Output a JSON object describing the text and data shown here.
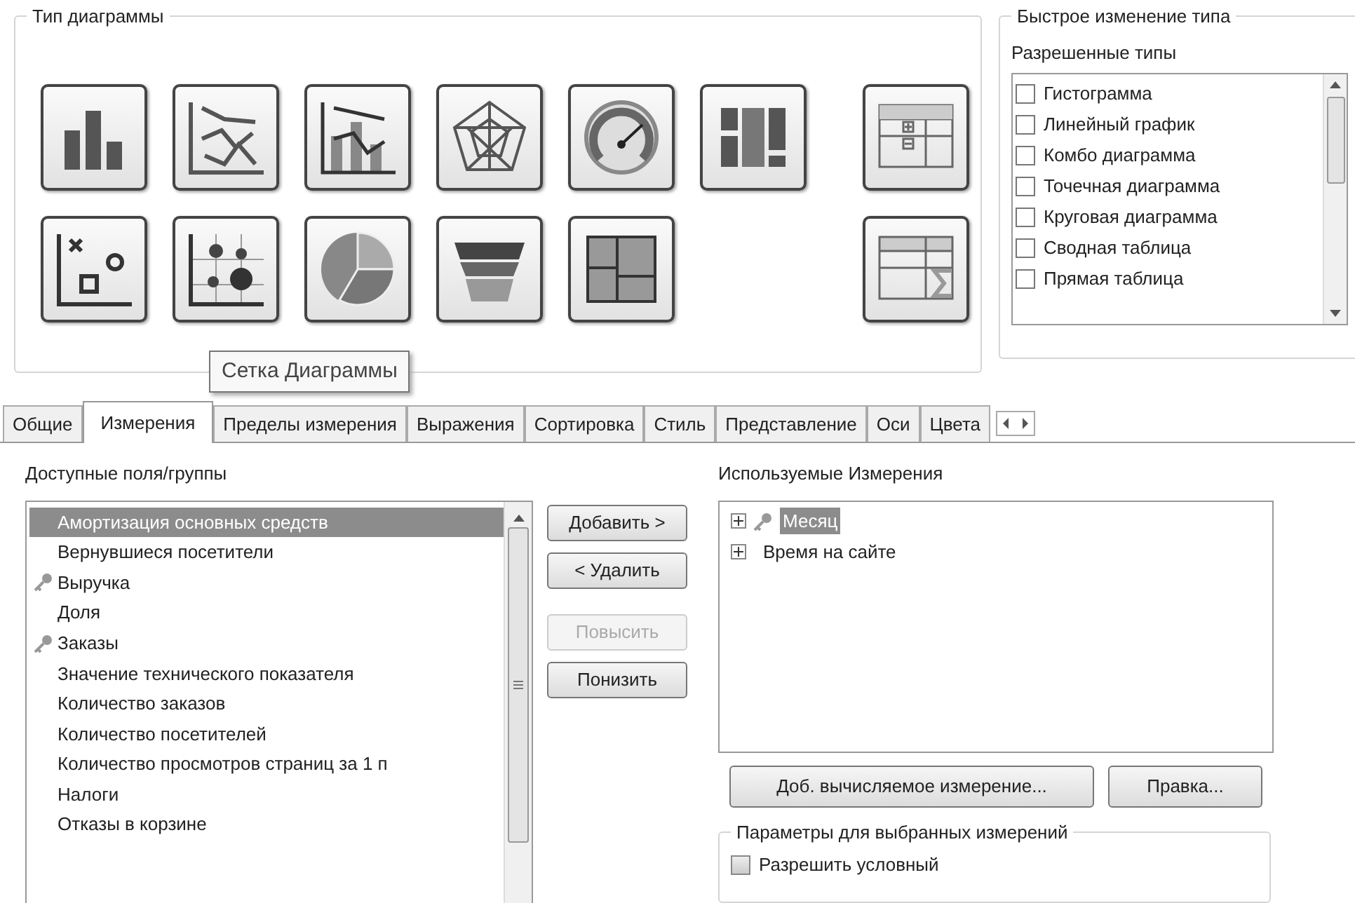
{
  "chart_type": {
    "title": "Тип диаграммы",
    "rows": [
      [
        {
          "kind": "bar"
        },
        {
          "kind": "line"
        },
        {
          "kind": "combo"
        },
        {
          "kind": "radar"
        },
        {
          "kind": "gauge"
        },
        {
          "kind": "block"
        }
      ],
      [
        {
          "kind": "scatter"
        },
        {
          "kind": "grid"
        },
        {
          "kind": "pie"
        },
        {
          "kind": "funnel"
        },
        {
          "kind": "mekko"
        }
      ]
    ],
    "side": [
      {
        "kind": "pivot"
      },
      {
        "kind": "straight"
      }
    ],
    "tooltip": "Сетка Диаграммы"
  },
  "quick_change": {
    "title": "Быстрое изменение типа",
    "label": "Разрешенные типы",
    "items": [
      {
        "label": "Гистограмма",
        "checked": false
      },
      {
        "label": "Линейный график",
        "checked": false
      },
      {
        "label": "Комбо диаграмма",
        "checked": false
      },
      {
        "label": "Точечная диаграмма",
        "checked": false
      },
      {
        "label": "Круговая диаграмма",
        "checked": false
      },
      {
        "label": "Сводная таблица",
        "checked": false
      },
      {
        "label": "Прямая таблица",
        "checked": false
      }
    ]
  },
  "tabs": [
    {
      "label": "Общие",
      "selected": false
    },
    {
      "label": "Измерения",
      "selected": true
    },
    {
      "label": "Пределы измерения",
      "selected": false
    },
    {
      "label": "Выражения",
      "selected": false
    },
    {
      "label": "Сортировка",
      "selected": false
    },
    {
      "label": "Стиль",
      "selected": false
    },
    {
      "label": "Представление",
      "selected": false
    },
    {
      "label": "Оси",
      "selected": false
    },
    {
      "label": "Цвета",
      "selected": false
    }
  ],
  "available": {
    "label": "Доступные поля/группы",
    "items": [
      {
        "label": "Амортизация основных средств",
        "kind": "plain",
        "selected": true
      },
      {
        "label": "Вернувшиеся посетители",
        "kind": "plain",
        "selected": false
      },
      {
        "label": "Выручка",
        "kind": "key",
        "selected": false
      },
      {
        "label": "Доля",
        "kind": "plain",
        "selected": false
      },
      {
        "label": "Заказы",
        "kind": "key",
        "selected": false
      },
      {
        "label": "Значение технического показателя",
        "kind": "plain",
        "selected": false
      },
      {
        "label": "Количество заказов",
        "kind": "plain",
        "selected": false
      },
      {
        "label": "Количество посетителей",
        "kind": "plain",
        "selected": false
      },
      {
        "label": "Количество просмотров страниц за 1 п",
        "kind": "plain",
        "selected": false
      },
      {
        "label": "Налоги",
        "kind": "plain",
        "selected": false
      },
      {
        "label": "Отказы в корзине",
        "kind": "plain",
        "selected": false
      }
    ]
  },
  "move_buttons": [
    {
      "label": "Добавить >",
      "disabled": false
    },
    {
      "label": "< Удалить",
      "disabled": false
    },
    {
      "label": "Повысить",
      "disabled": true
    },
    {
      "label": "Понизить",
      "disabled": false
    }
  ],
  "used": {
    "label": "Используемые Измерения",
    "items": [
      {
        "label": "Месяц",
        "kind": "key",
        "selected": true,
        "expanded": false
      },
      {
        "label": "Время на сайте",
        "kind": "plain",
        "selected": false,
        "expanded": false
      }
    ]
  },
  "used_buttons": [
    {
      "label": "Доб. вычисляемое измерение..."
    },
    {
      "label": "Правка..."
    }
  ],
  "params": {
    "title": "Параметры для выбранных измерений",
    "checkbox": {
      "label": "Разрешить условный",
      "checked": false
    }
  }
}
